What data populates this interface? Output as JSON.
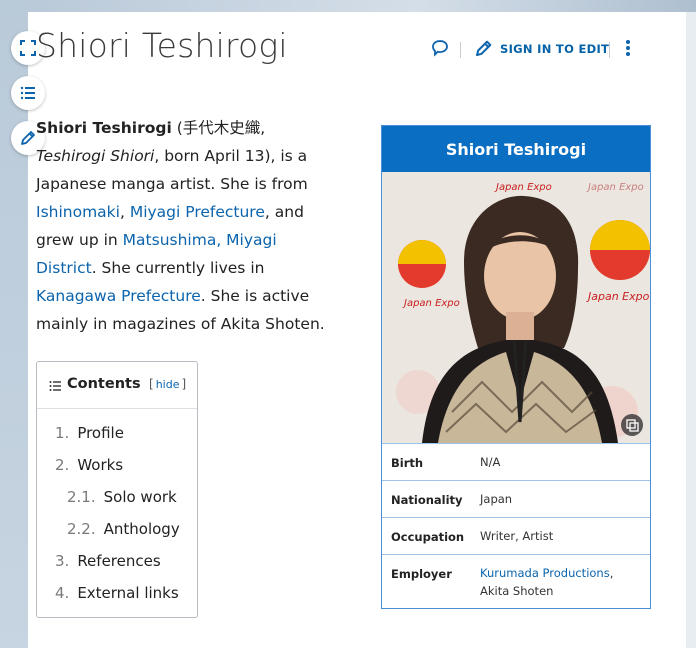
{
  "page": {
    "title": "Shiori Teshirogi"
  },
  "actions": {
    "talk_icon": "speech-bubble-icon",
    "edit_label": "SIGN IN TO EDIT",
    "edit_icon": "pencil-icon",
    "more_icon": "kebab-menu-icon"
  },
  "rail": {
    "fullscreen_icon": "expand-icon",
    "toc_icon": "list-icon",
    "edit_icon": "pencil-icon"
  },
  "lead": {
    "name_bold": "Shiori Teshirogi",
    "t1": " (手代木史織, ",
    "romaji_italic": "Teshirogi Shiori",
    "t2": ", born April 13), is a Japanese manga artist. She is from ",
    "link1": "Ishinomaki",
    "t3": ", ",
    "link2": "Miyagi Prefecture",
    "t4": ", and grew up in ",
    "link3": "Matsushima, Miyagi District",
    "t5": ". She currently lives in ",
    "link4": "Kanagawa Prefecture",
    "t6": ". She is active mainly in magazines of Akita Shoten."
  },
  "toc": {
    "title": "Contents",
    "hide_open": "[",
    "hide_label": "hide",
    "hide_close": "]",
    "items": [
      {
        "num": "1.",
        "label": "Profile"
      },
      {
        "num": "2.",
        "label": "Works"
      },
      {
        "num": "2.1.",
        "label": "Solo work"
      },
      {
        "num": "2.2.",
        "label": "Anthology"
      },
      {
        "num": "3.",
        "label": "References"
      },
      {
        "num": "4.",
        "label": "External links"
      }
    ]
  },
  "infobox": {
    "title": "Shiori Teshirogi",
    "photo_backdrop_text": [
      "Japan Expo",
      "Japan Expo",
      "Japan Expo",
      "Japan Expo"
    ],
    "rows": [
      {
        "label": "Birth",
        "value": "N/A"
      },
      {
        "label": "Nationality",
        "value": "Japan"
      },
      {
        "label": "Occupation",
        "value": "Writer, Artist"
      },
      {
        "label": "Employer",
        "value_link": "Kurumada Productions",
        "value_suffix": ",",
        "value_line2": "Akita Shoten"
      }
    ]
  },
  "colors": {
    "accent": "#0a6fc2",
    "link": "#0b64ad",
    "infobox_border": "#4a90d9"
  }
}
